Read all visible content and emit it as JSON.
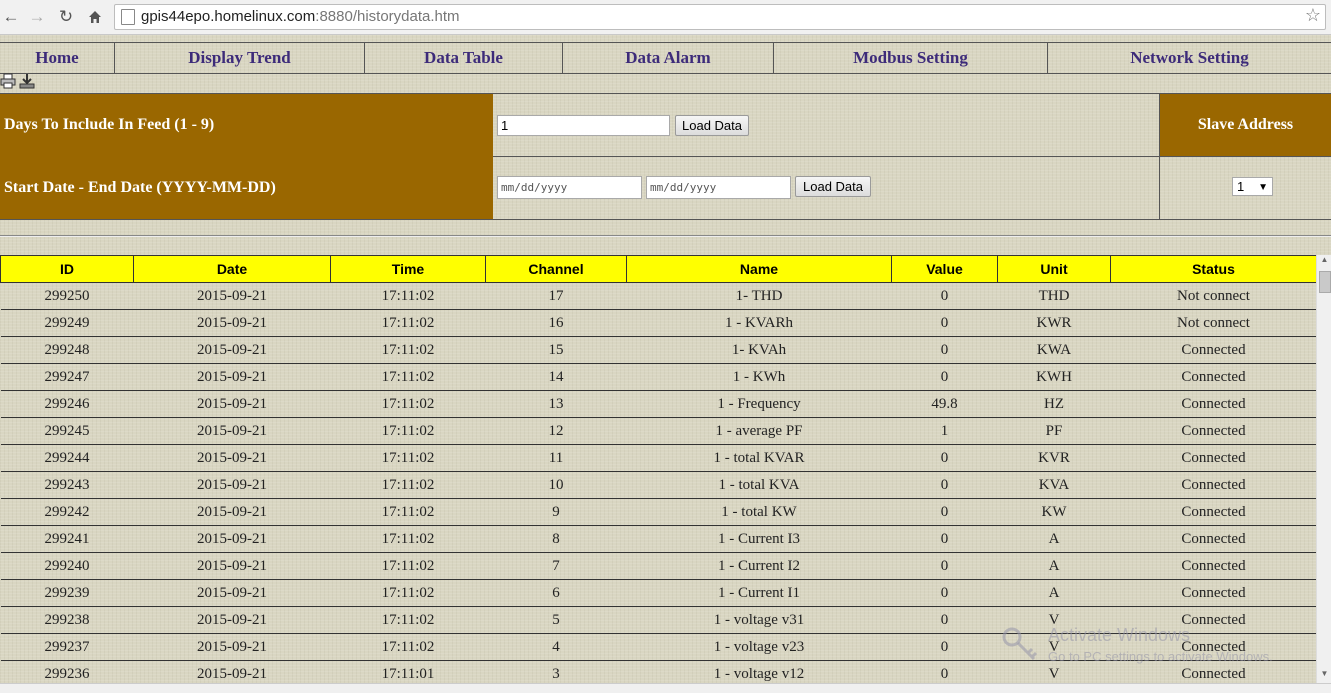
{
  "browser": {
    "url_host": "gpis44epo.homelinux.com",
    "url_path": ":8880/historydata.htm"
  },
  "menu": {
    "items": [
      "Home",
      "Display Trend",
      "Data Table",
      "Data Alarm",
      "Modbus Setting",
      "Network Setting"
    ]
  },
  "form": {
    "days_label": "Days To Include In Feed (1 - 9)",
    "days_value": "1",
    "load_label": "Load Data",
    "range_label": "Start Date - End Date (YYYY-MM-DD)",
    "start_placeholder": "mm/dd/yyyy",
    "end_placeholder": "mm/dd/yyyy",
    "load_label_2": "Load Data",
    "slave_label": "Slave Address",
    "slave_value": "1"
  },
  "table": {
    "headers": [
      "ID",
      "Date",
      "Time",
      "Channel",
      "Name",
      "Value",
      "Unit",
      "Status"
    ],
    "rows": [
      [
        "299250",
        "2015-09-21",
        "17:11:02",
        "17",
        "1- THD",
        "0",
        "THD",
        "Not connect"
      ],
      [
        "299249",
        "2015-09-21",
        "17:11:02",
        "16",
        "1 - KVARh",
        "0",
        "KWR",
        "Not connect"
      ],
      [
        "299248",
        "2015-09-21",
        "17:11:02",
        "15",
        "1- KVAh",
        "0",
        "KWA",
        "Connected"
      ],
      [
        "299247",
        "2015-09-21",
        "17:11:02",
        "14",
        "1 - KWh",
        "0",
        "KWH",
        "Connected"
      ],
      [
        "299246",
        "2015-09-21",
        "17:11:02",
        "13",
        "1 - Frequency",
        "49.8",
        "HZ",
        "Connected"
      ],
      [
        "299245",
        "2015-09-21",
        "17:11:02",
        "12",
        "1 - average PF",
        "1",
        "PF",
        "Connected"
      ],
      [
        "299244",
        "2015-09-21",
        "17:11:02",
        "11",
        "1 - total KVAR",
        "0",
        "KVR",
        "Connected"
      ],
      [
        "299243",
        "2015-09-21",
        "17:11:02",
        "10",
        "1 - total KVA",
        "0",
        "KVA",
        "Connected"
      ],
      [
        "299242",
        "2015-09-21",
        "17:11:02",
        "9",
        "1 - total KW",
        "0",
        "KW",
        "Connected"
      ],
      [
        "299241",
        "2015-09-21",
        "17:11:02",
        "8",
        "1 - Current I3",
        "0",
        "A",
        "Connected"
      ],
      [
        "299240",
        "2015-09-21",
        "17:11:02",
        "7",
        "1 - Current I2",
        "0",
        "A",
        "Connected"
      ],
      [
        "299239",
        "2015-09-21",
        "17:11:02",
        "6",
        "1 - Current I1",
        "0",
        "A",
        "Connected"
      ],
      [
        "299238",
        "2015-09-21",
        "17:11:02",
        "5",
        "1 - voltage v31",
        "0",
        "V",
        "Connected"
      ],
      [
        "299237",
        "2015-09-21",
        "17:11:02",
        "4",
        "1 - voltage v23",
        "0",
        "V",
        "Connected"
      ],
      [
        "299236",
        "2015-09-21",
        "17:11:01",
        "3",
        "1 - voltage v12",
        "0",
        "V",
        "Connected"
      ]
    ]
  },
  "watermark": {
    "line1": "Activate Windows",
    "line2": "Go to PC settings to activate Windows."
  },
  "colors": {
    "label_bg": "#9a6700",
    "header_bg": "#ffff00",
    "menu_text": "#3d2b7a"
  }
}
